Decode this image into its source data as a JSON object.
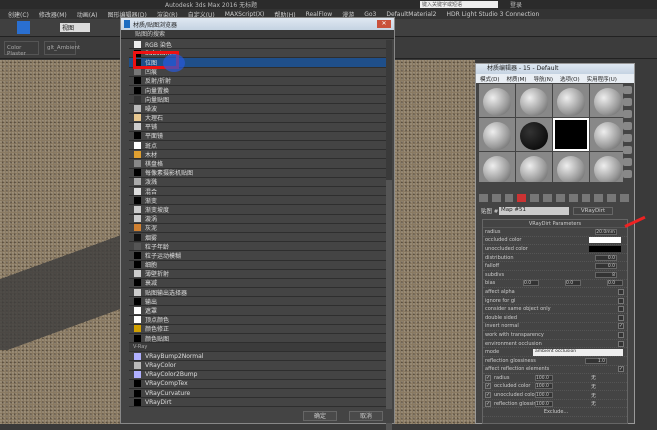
{
  "app": {
    "title": "Autodesk 3ds Max 2016   无标题",
    "search_placeholder": "键入关键字或短语",
    "user": "登录"
  },
  "menu": [
    "创建(C)",
    "修改器(M)",
    "动画(A)",
    "图形编辑器(D)",
    "渲染(R)",
    "自定义(U)",
    "MAXScript(X)",
    "帮助(H)",
    "RealFlow",
    "漫游",
    "Go3",
    "DefaultMaterial2",
    "HDR Light Studio 3 Connection"
  ],
  "toolbar": {
    "selection_filter": "视图"
  },
  "ribbon": [
    "Color Plaster",
    "glt_Ambient"
  ],
  "browser": {
    "title": "材质/贴图浏览器",
    "section": "贴图的搜索",
    "items": [
      {
        "label": "RGB 染色",
        "color": "#eeeeee"
      },
      {
        "label": "Substance",
        "color": "#000000"
      },
      {
        "label": "位图",
        "color": "#111111",
        "selected": true
      },
      {
        "label": "凹痕",
        "color": "#777777"
      },
      {
        "label": "反射/折射",
        "color": "#000000"
      },
      {
        "label": "向量置换",
        "color": "#000000"
      },
      {
        "label": "向量贴图",
        "color": "#333333"
      },
      {
        "label": "噪波",
        "color": "#bbbbbb"
      },
      {
        "label": "大理石",
        "color": "#e8c890"
      },
      {
        "label": "平铺",
        "color": "#cccccc"
      },
      {
        "label": "平面镜",
        "color": "#000000"
      },
      {
        "label": "斑点",
        "color": "#ffffff"
      },
      {
        "label": "木材",
        "color": "#e0a030"
      },
      {
        "label": "棋盘格",
        "color": "#888888"
      },
      {
        "label": "每像素摄影机贴图",
        "color": "#000000"
      },
      {
        "label": "泼溅",
        "color": "#aaaaaa"
      },
      {
        "label": "混合",
        "color": "#dddddd"
      },
      {
        "label": "渐变",
        "color": "#000000"
      },
      {
        "label": "渐变坡度",
        "color": "#cccccc"
      },
      {
        "label": "漩涡",
        "color": "#cccccc"
      },
      {
        "label": "灰泥",
        "color": "#d08030"
      },
      {
        "label": "烟雾",
        "color": "#111111"
      },
      {
        "label": "粒子年龄",
        "color": "#555555"
      },
      {
        "label": "粒子运动模糊",
        "color": "#000000"
      },
      {
        "label": "细胞",
        "color": "#000000"
      },
      {
        "label": "薄壁折射",
        "color": "#cccccc"
      },
      {
        "label": "衰减",
        "color": "#000000"
      },
      {
        "label": "贴图输出选择器",
        "color": "#cccccc"
      },
      {
        "label": "输出",
        "color": "#000000"
      },
      {
        "label": "遮罩",
        "color": "#ffffff"
      },
      {
        "label": "顶点颜色",
        "color": "#ffffff"
      },
      {
        "label": "颜色修正",
        "color": "#d0a000"
      },
      {
        "label": "颜色贴图",
        "color": "#000000"
      }
    ],
    "vray_group": "V-Ray",
    "vray_items": [
      {
        "label": "VRayBump2Normal",
        "color": "#b0b0ff"
      },
      {
        "label": "VRayColor",
        "color": "#bbbbbb"
      },
      {
        "label": "VRayColor2Bump",
        "color": "#b0b0ff"
      },
      {
        "label": "VRayCompTex",
        "color": "#000000"
      },
      {
        "label": "VRayCurvature",
        "color": "#000000"
      },
      {
        "label": "VRayDirt",
        "color": "#000000"
      }
    ],
    "ok": "确定",
    "cancel": "取消"
  },
  "editor": {
    "title": "材质编辑器 - 15 - Default",
    "menus": [
      "模式(D)",
      "材质(M)",
      "导航(N)",
      "选项(O)",
      "实用程序(U)"
    ],
    "map_label": "贴图 #",
    "map_name": "Map #51",
    "map_type": "VRayDirt",
    "rollout": "VRayDirt Parameters",
    "params": [
      {
        "label": "radius",
        "value": "20.0mm"
      },
      {
        "label": "occluded color",
        "swatch": "#ffffff"
      },
      {
        "label": "unoccluded color",
        "swatch": "#000000"
      },
      {
        "label": "distribution",
        "value": "0.0"
      },
      {
        "label": "falloff",
        "value": "0.0"
      },
      {
        "label": "subdivs",
        "value": "8"
      }
    ],
    "bias": {
      "label": "bias",
      "x": "0.0",
      "y": "0.0",
      "z": "0.0"
    },
    "checks": [
      {
        "label": "affect alpha",
        "checked": false
      },
      {
        "label": "ignore for gi",
        "checked": false
      },
      {
        "label": "consider same object only",
        "checked": false
      },
      {
        "label": "double sided",
        "checked": false
      },
      {
        "label": "invert normal",
        "checked": true
      },
      {
        "label": "work with transparency",
        "checked": false
      },
      {
        "label": "environment occlusion",
        "checked": false
      }
    ],
    "mode": {
      "label": "mode",
      "value": "ambient occlusion"
    },
    "refl_gloss": {
      "label": "reflection glossiness",
      "value": "1.0"
    },
    "affect_refl": {
      "label": "affect reflection elements",
      "checked": true
    },
    "maps": [
      {
        "label": "radius",
        "amount": "100.0",
        "map": "无"
      },
      {
        "label": "occluded color",
        "amount": "100.0",
        "map": "无"
      },
      {
        "label": "unoccluded color",
        "amount": "100.0",
        "map": "无"
      },
      {
        "label": "reflection glossiness",
        "amount": "100.0",
        "map": "无"
      }
    ],
    "exclude": "Exclude..."
  }
}
